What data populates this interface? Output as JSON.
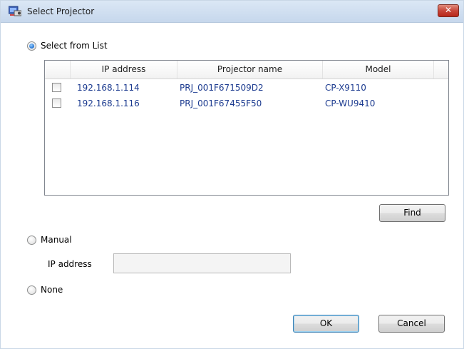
{
  "window": {
    "title": "Select Projector",
    "close_glyph": "✕"
  },
  "select_from_list": {
    "label": "Select from List",
    "checked": true
  },
  "list": {
    "columns": [
      "IP address",
      "Projector name",
      "Model"
    ],
    "rows": [
      {
        "checked": false,
        "ip": "192.168.1.114",
        "name": "PRJ_001F671509D2",
        "model": "CP-X9110"
      },
      {
        "checked": false,
        "ip": "192.168.1.116",
        "name": "PRJ_001F67455F50",
        "model": "CP-WU9410"
      }
    ]
  },
  "find_button": {
    "label": "Find"
  },
  "manual": {
    "label": "Manual",
    "checked": false,
    "ip_label": "IP address",
    "ip_value": ""
  },
  "none": {
    "label": "None",
    "checked": false
  },
  "footer": {
    "ok_label": "OK",
    "cancel_label": "Cancel"
  },
  "colors": {
    "link_blue": "#1b3a8f",
    "radio_selected": "#1f6fd0"
  }
}
